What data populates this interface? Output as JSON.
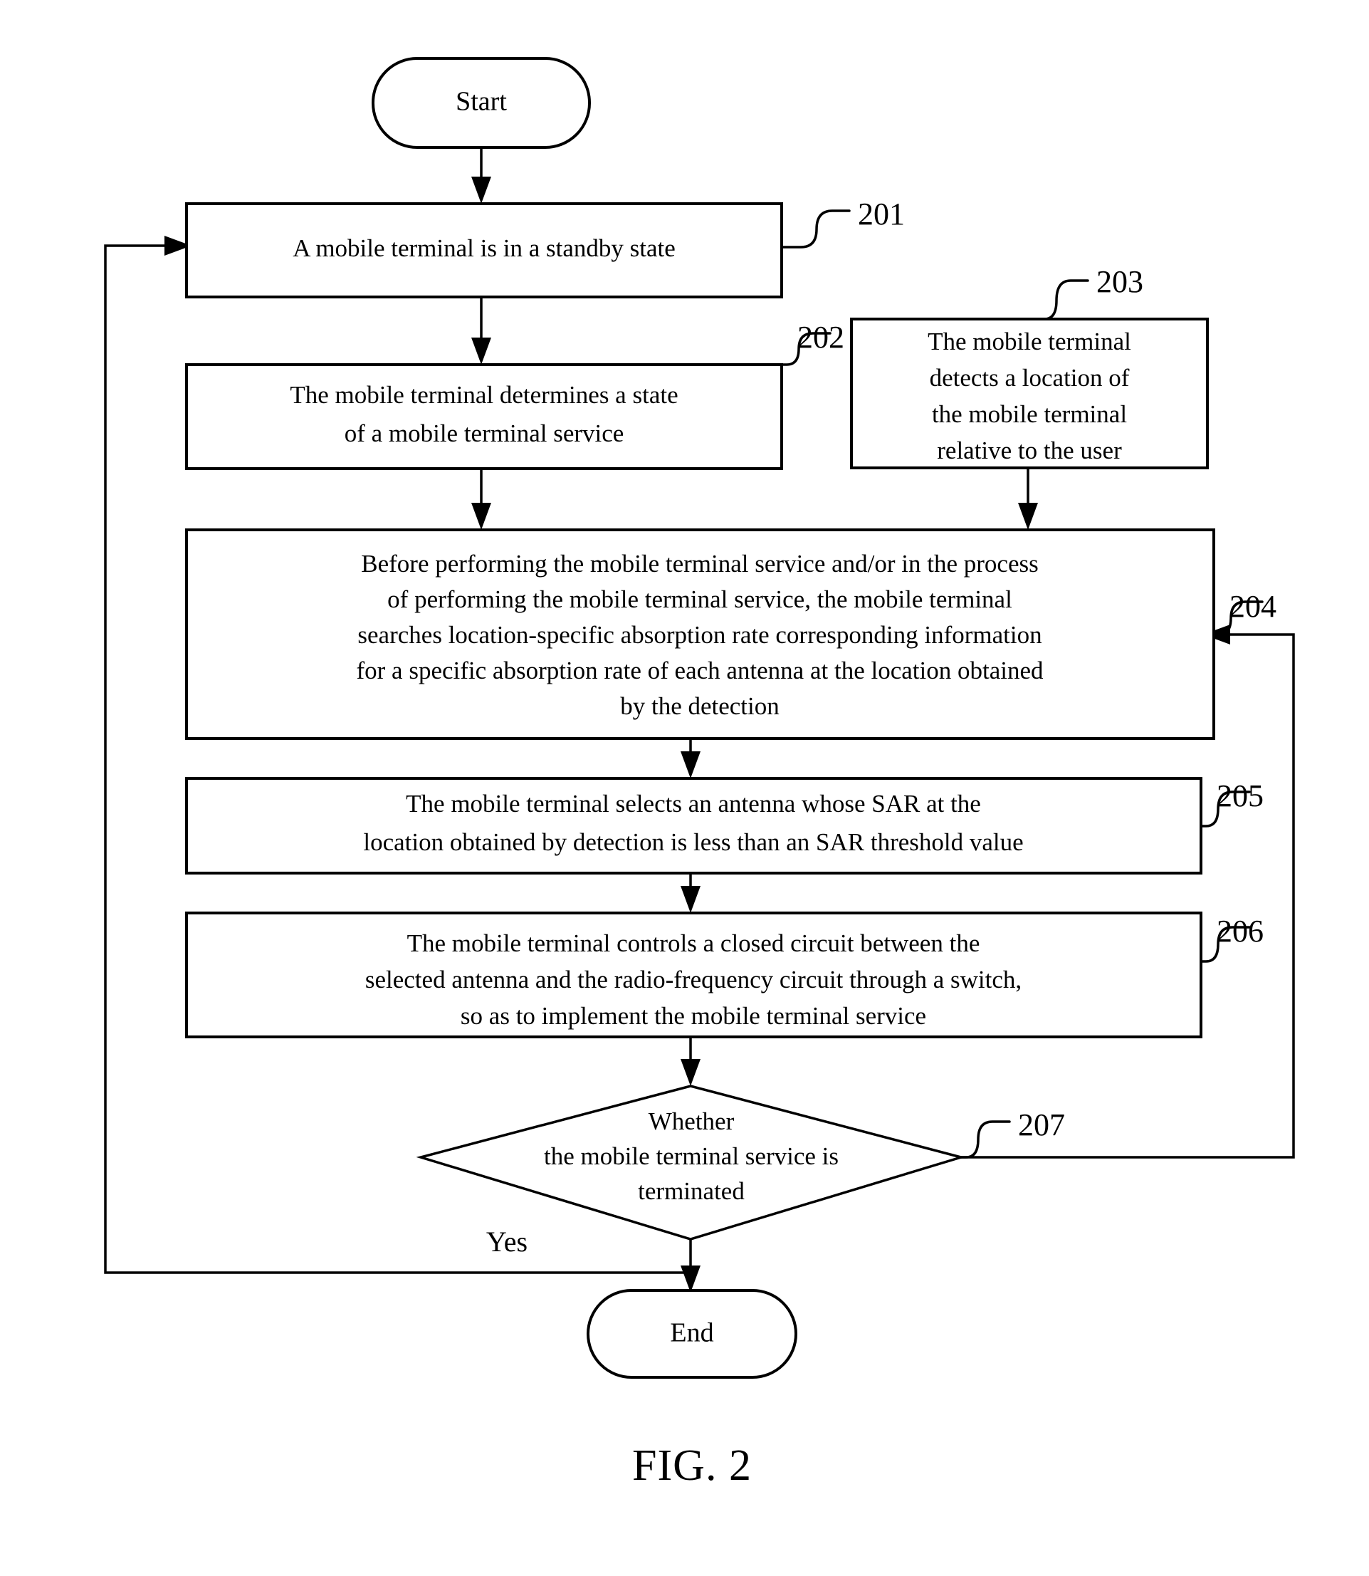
{
  "figure": {
    "caption": "FIG. 2"
  },
  "nodes": {
    "start": {
      "label": "Start",
      "shape": "terminator"
    },
    "end": {
      "label": "End",
      "shape": "terminator"
    },
    "step201": {
      "ref": "201",
      "shape": "process",
      "lines": [
        "A mobile terminal is in a standby state"
      ]
    },
    "step202": {
      "ref": "202",
      "shape": "process",
      "lines": [
        "The mobile terminal determines a state",
        "of a mobile terminal service"
      ]
    },
    "step203": {
      "ref": "203",
      "shape": "process",
      "lines": [
        "The mobile terminal",
        "detects a location of",
        "the mobile terminal",
        "relative to the user"
      ]
    },
    "step204": {
      "ref": "204",
      "shape": "process",
      "lines": [
        "Before performing the mobile terminal service and/or in the process",
        "of performing the mobile terminal service, the mobile terminal",
        "searches location-specific absorption rate corresponding information",
        "for a specific absorption rate of each antenna at the location obtained",
        "by the detection"
      ]
    },
    "step205": {
      "ref": "205",
      "shape": "process",
      "lines": [
        "The mobile terminal selects an antenna whose SAR at the",
        "location obtained by detection is less than an SAR threshold value"
      ]
    },
    "step206": {
      "ref": "206",
      "shape": "process",
      "lines": [
        "The mobile terminal controls a closed circuit between the",
        "selected antenna and the radio-frequency circuit through a switch,",
        "so as to implement the mobile terminal service"
      ]
    },
    "step207": {
      "ref": "207",
      "shape": "decision",
      "lines": [
        "Whether",
        "the mobile terminal service is",
        "terminated"
      ]
    }
  },
  "edges": {
    "yes_label": "Yes"
  },
  "colors": {
    "stroke": "#000000",
    "fill": "#ffffff",
    "background": "#ffffff"
  }
}
